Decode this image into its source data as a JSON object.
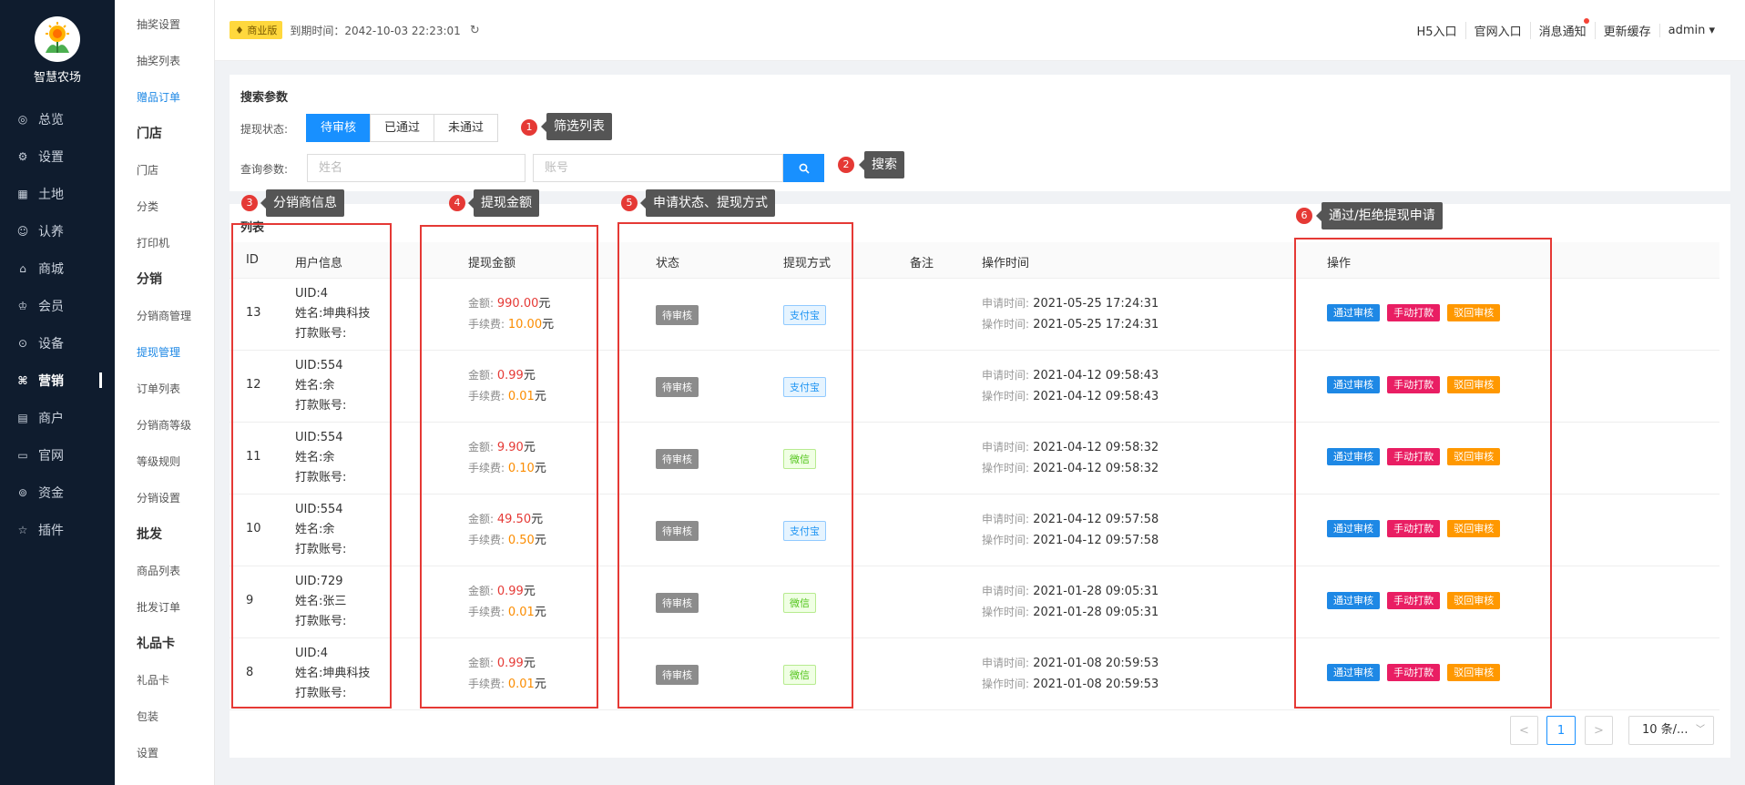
{
  "app": {
    "name": "智慧农场"
  },
  "nav": [
    {
      "label": "总览",
      "icon": "dashboard-icon",
      "glyph": "◎"
    },
    {
      "label": "设置",
      "icon": "settings-icon",
      "glyph": "⚙"
    },
    {
      "label": "土地",
      "icon": "grid-icon",
      "glyph": "▦"
    },
    {
      "label": "认养",
      "icon": "adopt-icon",
      "glyph": "☺"
    },
    {
      "label": "商城",
      "icon": "shop-icon",
      "glyph": "⌂"
    },
    {
      "label": "会员",
      "icon": "member-icon",
      "glyph": "♔"
    },
    {
      "label": "设备",
      "icon": "location-icon",
      "glyph": "⊙"
    },
    {
      "label": "营销",
      "icon": "marketing-icon",
      "glyph": "⌘",
      "active": true
    },
    {
      "label": "商户",
      "icon": "merchant-icon",
      "glyph": "▤"
    },
    {
      "label": "官网",
      "icon": "website-icon",
      "glyph": "▭"
    },
    {
      "label": "资金",
      "icon": "funds-icon",
      "glyph": "⊚"
    },
    {
      "label": "插件",
      "icon": "plugin-icon",
      "glyph": "☆"
    }
  ],
  "submenu": [
    {
      "label": "抽奖设置",
      "type": "item"
    },
    {
      "label": "抽奖列表",
      "type": "item"
    },
    {
      "label": "赠品订单",
      "type": "blue"
    },
    {
      "label": "门店",
      "type": "group"
    },
    {
      "label": "门店",
      "type": "item"
    },
    {
      "label": "分类",
      "type": "item"
    },
    {
      "label": "打印机",
      "type": "item"
    },
    {
      "label": "分销",
      "type": "group"
    },
    {
      "label": "分销商管理",
      "type": "item"
    },
    {
      "label": "提现管理",
      "type": "blue"
    },
    {
      "label": "订单列表",
      "type": "item"
    },
    {
      "label": "分销商等级",
      "type": "item"
    },
    {
      "label": "等级规则",
      "type": "item"
    },
    {
      "label": "分销设置",
      "type": "item"
    },
    {
      "label": "批发",
      "type": "group"
    },
    {
      "label": "商品列表",
      "type": "item"
    },
    {
      "label": "批发订单",
      "type": "item"
    },
    {
      "label": "礼品卡",
      "type": "group"
    },
    {
      "label": "礼品卡",
      "type": "item"
    },
    {
      "label": "包装",
      "type": "item"
    },
    {
      "label": "设置",
      "type": "item"
    }
  ],
  "topbar": {
    "edition": "商业版",
    "expire_label": "到期时间：2042-10-03 22:23:01",
    "links": [
      "H5入口",
      "官网入口",
      "消息通知",
      "更新缓存",
      "admin ▾"
    ]
  },
  "search": {
    "title": "搜索参数",
    "status_label": "提现状态:",
    "status_options": [
      "待审核",
      "已通过",
      "未通过"
    ],
    "query_label": "查询参数:",
    "name_placeholder": "姓名",
    "account_placeholder": "账号"
  },
  "table": {
    "title": "列表",
    "headers": {
      "id": "ID",
      "user": "用户信息",
      "amount": "提现金额",
      "status": "状态",
      "method": "提现方式",
      "remark": "备注",
      "time": "操作时间",
      "action": "操作"
    },
    "labels": {
      "amount": "金额:",
      "fee": "手续费:",
      "unit": "元",
      "apply": "申请时间:",
      "op": "操作时间:",
      "name_prefix": "姓名:",
      "account": "打款账号:"
    },
    "actions": [
      "通过审核",
      "手动打款",
      "驳回审核"
    ],
    "rows": [
      {
        "id": "13",
        "uid": "UID:4",
        "name": "姓名:坤典科技",
        "account": "打款账号:",
        "amount": "990.00",
        "fee": "10.00",
        "status": "待审核",
        "method": "支付宝",
        "method_type": "alipay",
        "apply_time": "2021-05-25 17:24:31",
        "op_time": "2021-05-25 17:24:31"
      },
      {
        "id": "12",
        "uid": "UID:554",
        "name": "姓名:余",
        "account": "打款账号:",
        "amount": "0.99",
        "fee": "0.01",
        "status": "待审核",
        "method": "支付宝",
        "method_type": "alipay",
        "apply_time": "2021-04-12 09:58:43",
        "op_time": "2021-04-12 09:58:43"
      },
      {
        "id": "11",
        "uid": "UID:554",
        "name": "姓名:余",
        "account": "打款账号:",
        "amount": "9.90",
        "fee": "0.10",
        "status": "待审核",
        "method": "微信",
        "method_type": "wechat",
        "apply_time": "2021-04-12 09:58:32",
        "op_time": "2021-04-12 09:58:32"
      },
      {
        "id": "10",
        "uid": "UID:554",
        "name": "姓名:余",
        "account": "打款账号:",
        "amount": "49.50",
        "fee": "0.50",
        "status": "待审核",
        "method": "支付宝",
        "method_type": "alipay",
        "apply_time": "2021-04-12 09:57:58",
        "op_time": "2021-04-12 09:57:58"
      },
      {
        "id": "9",
        "uid": "UID:729",
        "name": "姓名:张三",
        "account": "打款账号:",
        "amount": "0.99",
        "fee": "0.01",
        "status": "待审核",
        "method": "微信",
        "method_type": "wechat",
        "apply_time": "2021-01-28 09:05:31",
        "op_time": "2021-01-28 09:05:31"
      },
      {
        "id": "8",
        "uid": "UID:4",
        "name": "姓名:坤典科技",
        "account": "打款账号:",
        "amount": "0.99",
        "fee": "0.01",
        "status": "待审核",
        "method": "微信",
        "method_type": "wechat",
        "apply_time": "2021-01-08 20:59:53",
        "op_time": "2021-01-08 20:59:53"
      }
    ]
  },
  "pagination": {
    "prev": "<",
    "current": "1",
    "next": ">",
    "page_size": "10 条/..."
  },
  "annotations": [
    {
      "num": "1",
      "text": "筛选列表"
    },
    {
      "num": "2",
      "text": "搜索"
    },
    {
      "num": "3",
      "text": "分销商信息"
    },
    {
      "num": "4",
      "text": "提现金额"
    },
    {
      "num": "5",
      "text": "申请状态、提现方式"
    },
    {
      "num": "6",
      "text": "通过/拒绝提现申请"
    }
  ],
  "colors": {
    "primary": "#1890ff",
    "sidebar": "#0f1c2e",
    "annotation_red": "#e53935"
  }
}
